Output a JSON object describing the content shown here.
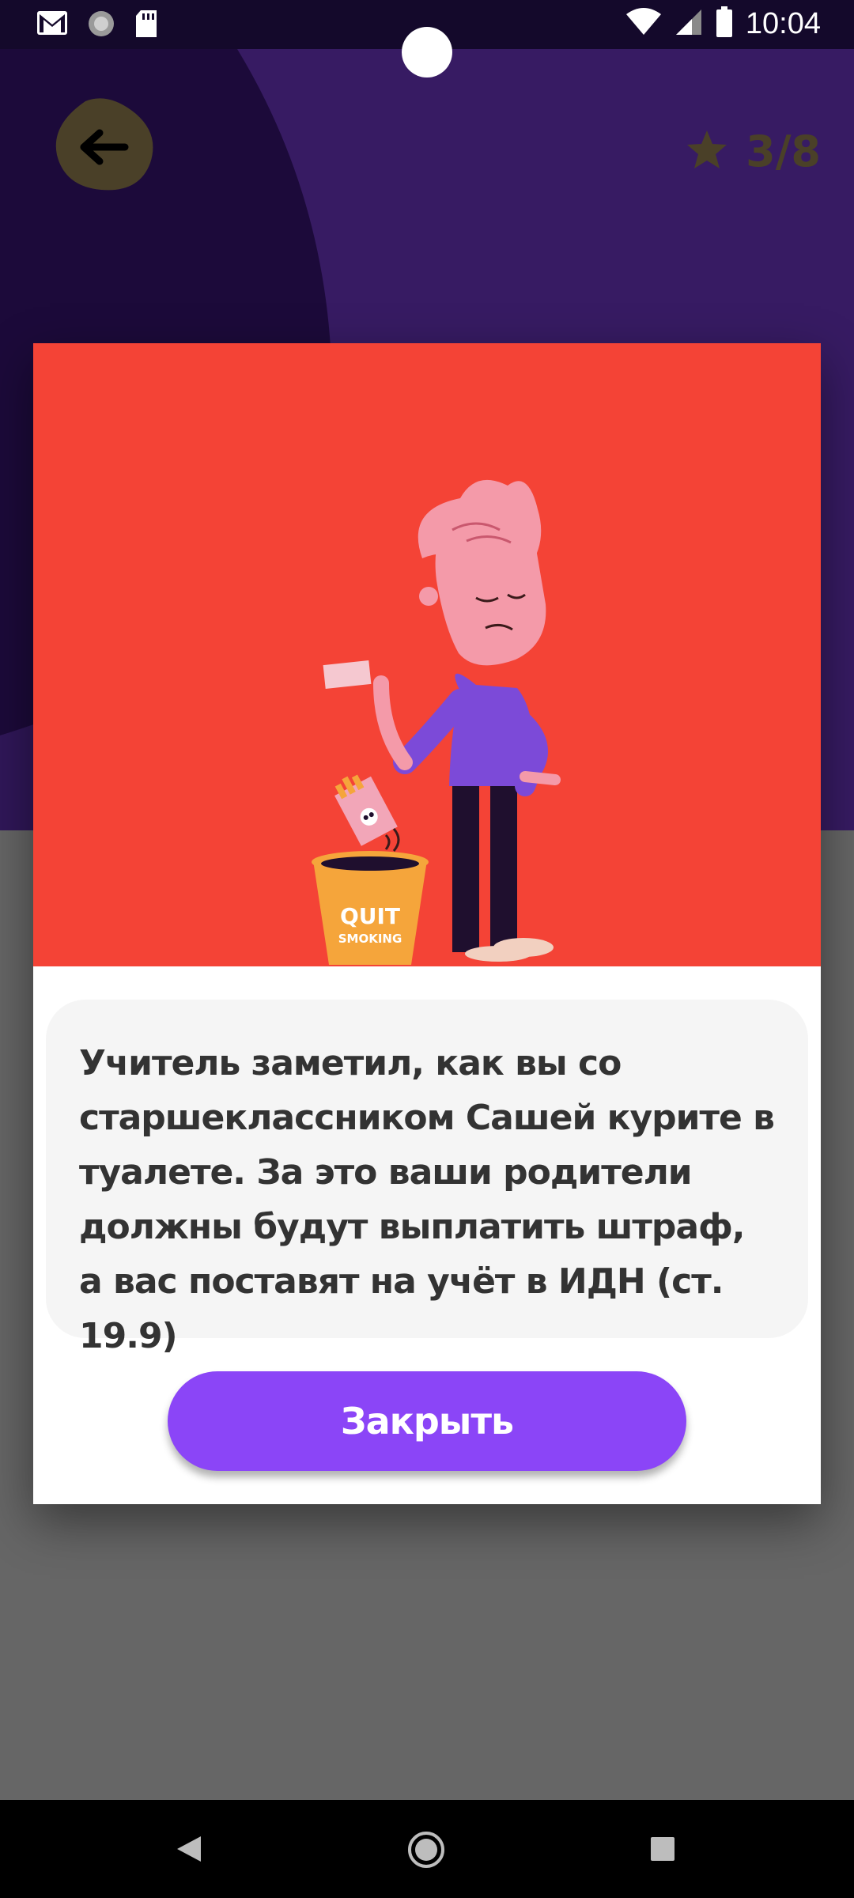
{
  "status_bar": {
    "time": "10:04",
    "left_icons": [
      "gmail-icon",
      "sync-icon",
      "sd-card-icon"
    ],
    "right_icons": [
      "wifi-icon",
      "cellular-icon",
      "battery-icon"
    ]
  },
  "header": {
    "back_icon": "arrow-left-icon",
    "progress": {
      "icon": "star-icon",
      "text": "3/8",
      "current": 3,
      "total": 8
    }
  },
  "dialog": {
    "illustration": {
      "bin_text_line1": "QUIT",
      "bin_text_line2": "SMOKING"
    },
    "message": "Учитель заметил, как вы со старшеклассником Сашей курите в туалете. За это ваши родители должны будут выплатить штраф, а вас поставят на учёт в ИДН (ст. 19.9)",
    "close_label": "Закрыть"
  },
  "nav_bar": {
    "buttons": [
      "back-triangle-icon",
      "home-circle-icon",
      "recents-square-icon"
    ]
  },
  "colors": {
    "background_purple": "#1c0a3a",
    "dim_gray": "#666666",
    "illustration_red": "#f44336",
    "button_purple": "#8b45f7",
    "back_blob": "#4a4028",
    "message_bg": "#f5f5f5"
  }
}
